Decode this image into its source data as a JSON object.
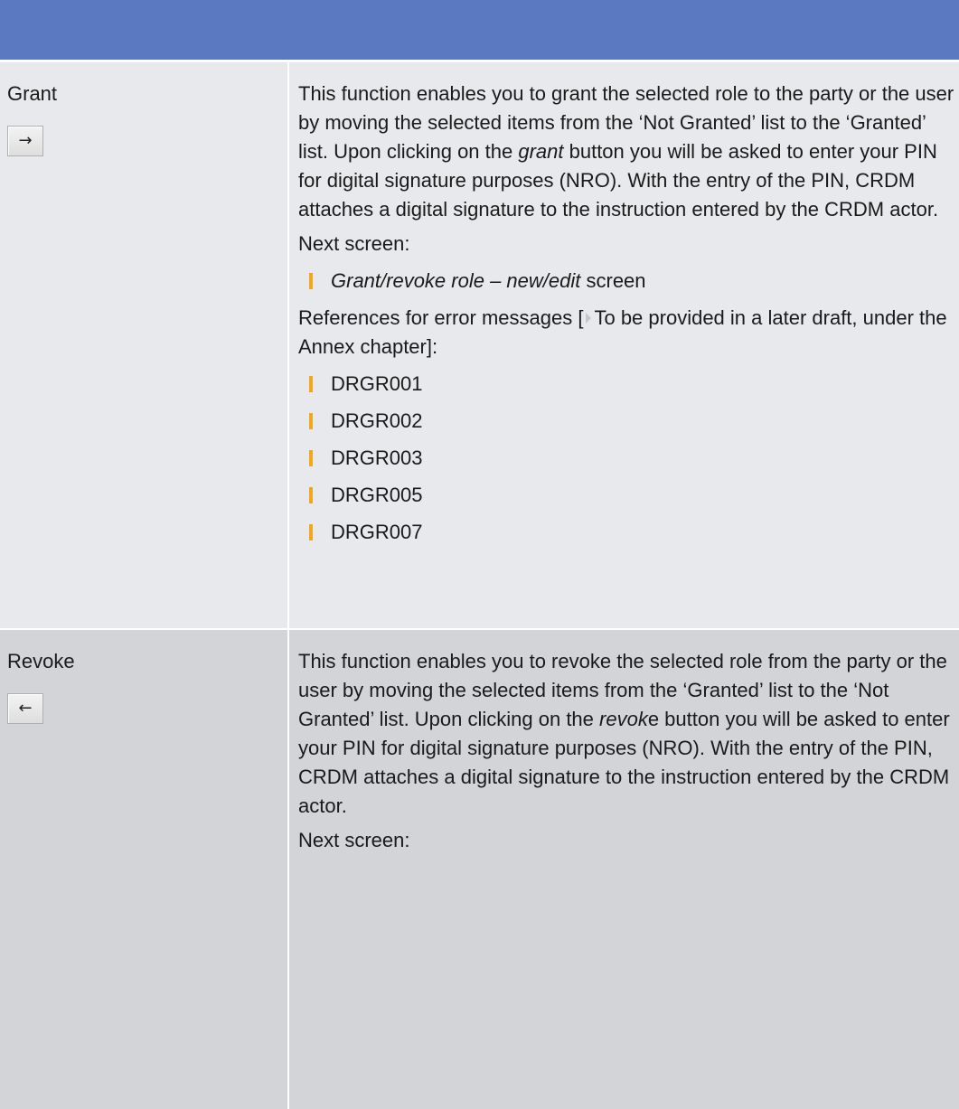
{
  "header": {
    "left": "",
    "right": ""
  },
  "grant": {
    "name": "Grant",
    "button_icon": "right-arrow-icon",
    "button_glyph": "→",
    "desc_part1": "This function enables you to grant the selected role to the party or the user by moving the selected items from the ‘Not Granted’ list to the ‘Granted’ list. Upon clicking on the ",
    "desc_italic": "grant",
    "desc_part2": " button you will be asked to enter your PIN for digital signature purposes (NRO). With the entry of the PIN, CRDM attaches a digital signature to the instruction entered by the CRDM actor.",
    "next_screen_label": "Next screen:",
    "next_screen_italic": "Grant/revoke role – new/edit",
    "next_screen_suffix": " screen",
    "refs_prefix": "References for error messages [",
    "refs_link": "To be provided in a later draft, under the Annex chapter",
    "refs_suffix": "]:",
    "error_codes": [
      "DRGR001",
      "DRGR002",
      "DRGR003",
      "DRGR005",
      "DRGR007"
    ]
  },
  "revoke": {
    "name": "Revoke",
    "button_icon": "left-arrow-icon",
    "button_glyph": "←",
    "desc_part1": "This function enables you to revoke the selected role from the party or the user by moving the selected items from the ‘Granted’ list to the ‘Not Granted’ list. Upon clicking on the ",
    "desc_italic": "revok",
    "desc_part2": "e button you will be asked to enter your PIN for digital signature purposes (NRO). With the entry of the PIN, CRDM attaches a digital signature to the instruction entered by the CRDM actor.",
    "next_screen_label": "Next screen:"
  },
  "colors": {
    "header": "#5b79c1",
    "row_light": "#e7e9ec",
    "row_dark": "#d3d4d7",
    "bullet": "#f0a81c"
  }
}
